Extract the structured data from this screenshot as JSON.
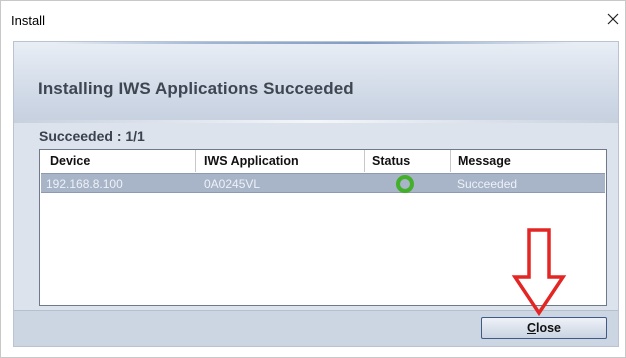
{
  "window": {
    "title": "Install"
  },
  "dialog": {
    "header_title": "Installing IWS Applications Succeeded",
    "summary": "Succeeded : 1/1",
    "table": {
      "columns": [
        "Device",
        "IWS Application",
        "Status",
        "Message"
      ],
      "rows": [
        {
          "device": "192.168.8.100",
          "application": "0A0245VL",
          "status": "ok-ring-icon",
          "message": "Succeeded"
        }
      ]
    },
    "close_button": {
      "accel": "C",
      "rest": "lose"
    }
  },
  "annotation": {
    "arrow_color": "#e32624"
  },
  "colors": {
    "status_ok": "#43b02a",
    "selected_row": "#a8b4c8",
    "button_border": "#3f5a86"
  }
}
